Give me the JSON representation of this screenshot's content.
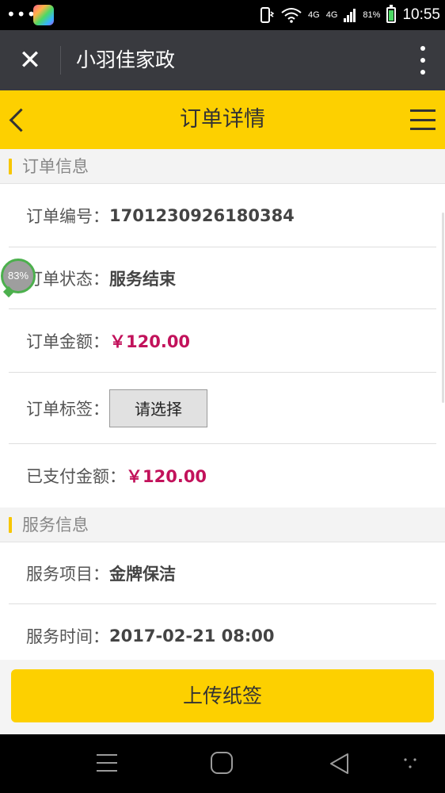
{
  "status_bar": {
    "dots": "•••",
    "signal_top": "4G",
    "signal_bottom": "4G",
    "battery": "81%",
    "time": "10:55"
  },
  "title_bar": {
    "title": "小羽佳家政"
  },
  "page_header": {
    "title": "订单详情"
  },
  "progress_bubble": {
    "value": "83%"
  },
  "sections": {
    "order_info": {
      "title": "订单信息",
      "order_no_label": "订单编号：",
      "order_no": "1701230926180384",
      "status_label": "订单状态：",
      "status": "服务结束",
      "amount_label": "订单金额：",
      "amount": "￥120.00",
      "tag_label": "订单标签：",
      "tag_select": "请选择",
      "paid_label": "已支付金额：",
      "paid": "￥120.00"
    },
    "service_info": {
      "title": "服务信息",
      "item_label": "服务项目：",
      "item": "金牌保洁",
      "time_label": "服务时间：",
      "time": "2017-02-21 08:00"
    }
  },
  "actions": {
    "upload_label": "上传纸签"
  },
  "colors": {
    "accent": "#fdd000",
    "price": "#c2125b",
    "titlebar": "#393a3f"
  }
}
